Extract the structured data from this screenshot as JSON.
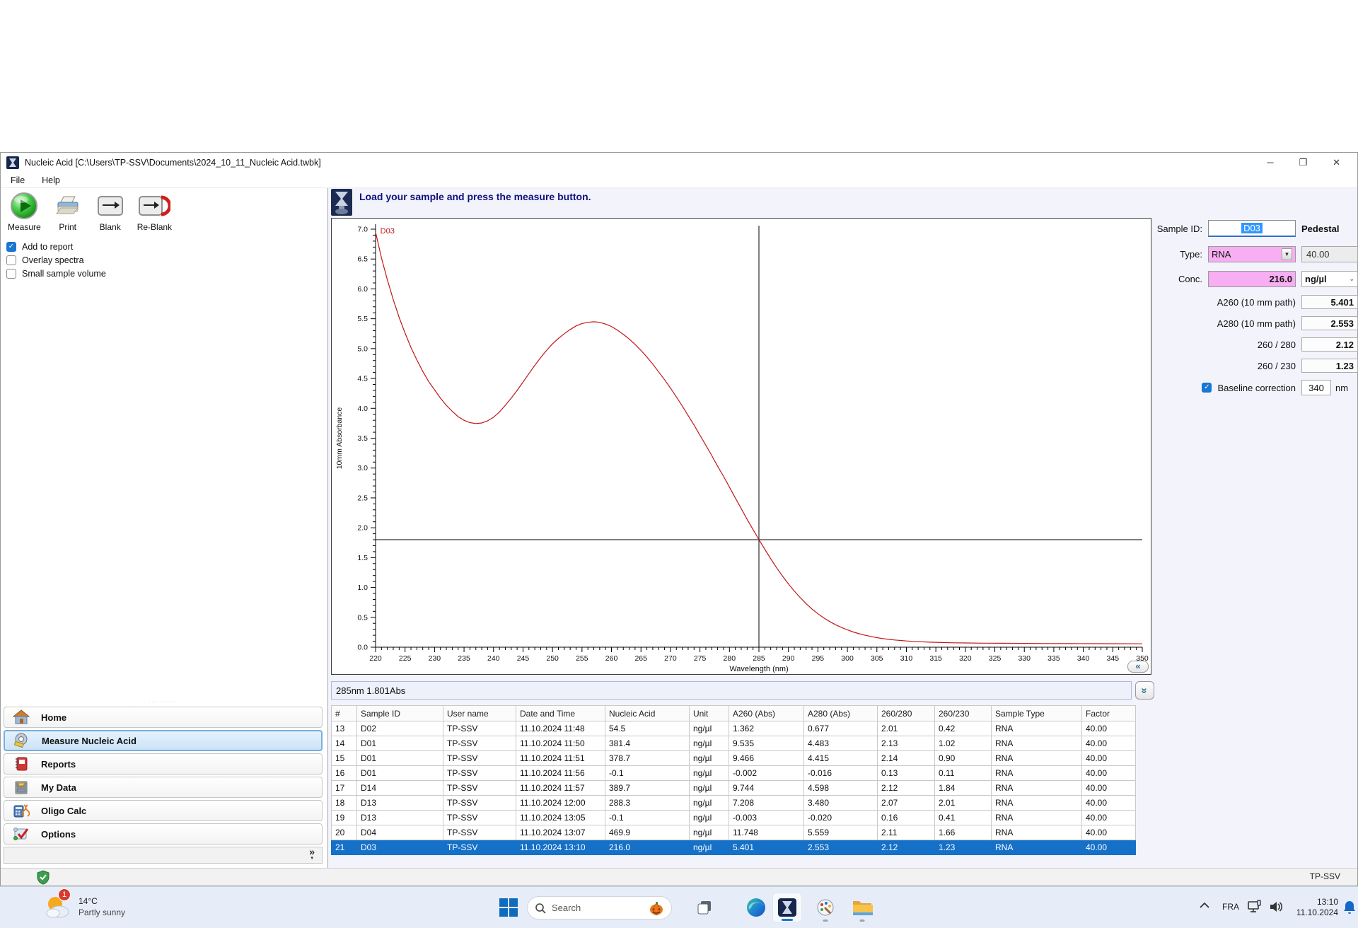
{
  "window": {
    "title": "Nucleic Acid  [C:\\Users\\TP-SSV\\Documents\\2024_10_11_Nucleic Acid.twbk]",
    "menu": [
      "File",
      "Help"
    ],
    "controls": {
      "minimize": "─",
      "maximize": "❐",
      "close": "✕"
    }
  },
  "toolbar": {
    "measure": "Measure",
    "print": "Print",
    "blank": "Blank",
    "reblank": "Re-Blank"
  },
  "options": [
    {
      "label": "Add to report",
      "checked": true
    },
    {
      "label": "Overlay spectra",
      "checked": false
    },
    {
      "label": "Small sample volume",
      "checked": false
    }
  ],
  "sidebar": {
    "items": [
      {
        "label": "Home"
      },
      {
        "label": "Measure Nucleic Acid"
      },
      {
        "label": "Reports"
      },
      {
        "label": "My Data"
      },
      {
        "label": "Oligo Calc"
      },
      {
        "label": "Options"
      }
    ],
    "selected_index": 1,
    "footer_glyph": "»",
    "footer_arrow": "▾"
  },
  "message_bar": {
    "text": "Load your sample and press the measure button."
  },
  "chart_data": {
    "type": "line",
    "title": "",
    "xlabel": "Wavelength (nm)",
    "ylabel": "10mm Absorbance",
    "xlim": [
      220,
      350
    ],
    "ylim": [
      0,
      7
    ],
    "x_major_step": 5,
    "x_minor_step": 1,
    "y_major_step": 0.5,
    "y_minor_step": 0.1,
    "grid": false,
    "crosshair": {
      "x": 285,
      "y": 1.801
    },
    "series": [
      {
        "name": "D03",
        "color": "#c01818",
        "label_pos": {
          "x": 220.8,
          "y": 6.93
        },
        "points": [
          [
            220,
            6.95
          ],
          [
            221,
            6.52
          ],
          [
            222,
            6.15
          ],
          [
            223,
            5.82
          ],
          [
            224,
            5.52
          ],
          [
            225,
            5.26
          ],
          [
            226,
            5.02
          ],
          [
            227,
            4.81
          ],
          [
            228,
            4.62
          ],
          [
            229,
            4.45
          ],
          [
            230,
            4.31
          ],
          [
            231,
            4.17
          ],
          [
            232,
            4.05
          ],
          [
            233,
            3.95
          ],
          [
            234,
            3.86
          ],
          [
            235,
            3.8
          ],
          [
            236,
            3.76
          ],
          [
            237,
            3.745
          ],
          [
            238,
            3.755
          ],
          [
            239,
            3.79
          ],
          [
            240,
            3.85
          ],
          [
            241,
            3.94
          ],
          [
            242,
            4.05
          ],
          [
            243,
            4.17
          ],
          [
            244,
            4.3
          ],
          [
            245,
            4.44
          ],
          [
            246,
            4.58
          ],
          [
            247,
            4.72
          ],
          [
            248,
            4.85
          ],
          [
            249,
            4.97
          ],
          [
            250,
            5.08
          ],
          [
            251,
            5.17
          ],
          [
            252,
            5.25
          ],
          [
            253,
            5.32
          ],
          [
            254,
            5.38
          ],
          [
            255,
            5.42
          ],
          [
            256,
            5.44
          ],
          [
            257,
            5.45
          ],
          [
            258,
            5.44
          ],
          [
            259,
            5.41
          ],
          [
            260,
            5.37
          ],
          [
            261,
            5.31
          ],
          [
            262,
            5.24
          ],
          [
            263,
            5.16
          ],
          [
            264,
            5.07
          ],
          [
            265,
            4.97
          ],
          [
            266,
            4.86
          ],
          [
            267,
            4.74
          ],
          [
            268,
            4.61
          ],
          [
            269,
            4.48
          ],
          [
            270,
            4.34
          ],
          [
            271,
            4.19
          ],
          [
            272,
            4.04
          ],
          [
            273,
            3.88
          ],
          [
            274,
            3.72
          ],
          [
            275,
            3.55
          ],
          [
            276,
            3.38
          ],
          [
            277,
            3.21
          ],
          [
            278,
            3.03
          ],
          [
            279,
            2.86
          ],
          [
            280,
            2.68
          ],
          [
            281,
            2.5
          ],
          [
            282,
            2.32
          ],
          [
            283,
            2.14
          ],
          [
            284,
            1.97
          ],
          [
            285,
            1.801
          ],
          [
            286,
            1.64
          ],
          [
            287,
            1.48
          ],
          [
            288,
            1.33
          ],
          [
            289,
            1.19
          ],
          [
            290,
            1.06
          ],
          [
            291,
            0.94
          ],
          [
            292,
            0.83
          ],
          [
            293,
            0.73
          ],
          [
            294,
            0.64
          ],
          [
            295,
            0.56
          ],
          [
            296,
            0.49
          ],
          [
            297,
            0.43
          ],
          [
            298,
            0.375
          ],
          [
            299,
            0.33
          ],
          [
            300,
            0.29
          ],
          [
            301,
            0.255
          ],
          [
            302,
            0.225
          ],
          [
            303,
            0.2
          ],
          [
            304,
            0.18
          ],
          [
            305,
            0.16
          ],
          [
            306,
            0.145
          ],
          [
            307,
            0.132
          ],
          [
            308,
            0.121
          ],
          [
            309,
            0.112
          ],
          [
            310,
            0.104
          ],
          [
            312,
            0.092
          ],
          [
            314,
            0.084
          ],
          [
            316,
            0.078
          ],
          [
            318,
            0.074
          ],
          [
            320,
            0.071
          ],
          [
            323,
            0.068
          ],
          [
            326,
            0.066
          ],
          [
            330,
            0.064
          ],
          [
            334,
            0.062
          ],
          [
            338,
            0.06
          ],
          [
            342,
            0.059
          ],
          [
            346,
            0.058
          ],
          [
            350,
            0.057
          ]
        ]
      }
    ]
  },
  "spectrum_status": "285nm 1.801Abs",
  "chart_buttons": {
    "collapse": "«",
    "expand": "»"
  },
  "right_panel": {
    "sample_id_label": "Sample ID:",
    "sample_id_value": "D03",
    "mode": "Pedestal",
    "type_label": "Type:",
    "type_value": "RNA",
    "factor_value": "40.00",
    "conc_label": "Conc.",
    "conc_value": "216.0",
    "conc_unit": "ng/µl",
    "a260_label": "A260 (10 mm path)",
    "a260_value": "5.401",
    "a280_label": "A280 (10 mm path)",
    "a280_value": "2.553",
    "ratio1_label": "260 / 280",
    "ratio1_value": "2.12",
    "ratio2_label": "260 / 230",
    "ratio2_value": "1.23",
    "baseline": {
      "label": "Baseline correction",
      "checked": true,
      "value": "340",
      "unit": "nm"
    }
  },
  "table": {
    "headers": [
      "#",
      "Sample ID",
      "User name",
      "Date and Time",
      "Nucleic Acid",
      "Unit",
      "A260 (Abs)",
      "A280 (Abs)",
      "260/280",
      "260/230",
      "Sample Type",
      "Factor"
    ],
    "selected_row": 8,
    "rows": [
      [
        "13",
        "D02",
        "TP-SSV",
        "11.10.2024 11:48",
        "54.5",
        "ng/µl",
        "1.362",
        "0.677",
        "2.01",
        "0.42",
        "RNA",
        "40.00"
      ],
      [
        "14",
        "D01",
        "TP-SSV",
        "11.10.2024 11:50",
        "381.4",
        "ng/µl",
        "9.535",
        "4.483",
        "2.13",
        "1.02",
        "RNA",
        "40.00"
      ],
      [
        "15",
        "D01",
        "TP-SSV",
        "11.10.2024 11:51",
        "378.7",
        "ng/µl",
        "9.466",
        "4.415",
        "2.14",
        "0.90",
        "RNA",
        "40.00"
      ],
      [
        "16",
        "D01",
        "TP-SSV",
        "11.10.2024 11:56",
        "-0.1",
        "ng/µl",
        "-0.002",
        "-0.016",
        "0.13",
        "0.11",
        "RNA",
        "40.00"
      ],
      [
        "17",
        "D14",
        "TP-SSV",
        "11.10.2024 11:57",
        "389.7",
        "ng/µl",
        "9.744",
        "4.598",
        "2.12",
        "1.84",
        "RNA",
        "40.00"
      ],
      [
        "18",
        "D13",
        "TP-SSV",
        "11.10.2024 12:00",
        "288.3",
        "ng/µl",
        "7.208",
        "3.480",
        "2.07",
        "2.01",
        "RNA",
        "40.00"
      ],
      [
        "19",
        "D13",
        "TP-SSV",
        "11.10.2024 13:05",
        "-0.1",
        "ng/µl",
        "-0.003",
        "-0.020",
        "0.16",
        "0.41",
        "RNA",
        "40.00"
      ],
      [
        "20",
        "D04",
        "TP-SSV",
        "11.10.2024 13:07",
        "469.9",
        "ng/µl",
        "11.748",
        "5.559",
        "2.11",
        "1.66",
        "RNA",
        "40.00"
      ],
      [
        "21",
        "D03",
        "TP-SSV",
        "11.10.2024 13:10",
        "216.0",
        "ng/µl",
        "5.401",
        "2.553",
        "2.12",
        "1.23",
        "RNA",
        "40.00"
      ]
    ]
  },
  "app_status": {
    "user": "TP-SSV"
  },
  "taskbar": {
    "weather": {
      "temp": "14°C",
      "condition": "Partly sunny",
      "badge": "1"
    },
    "search_placeholder": "Search",
    "language": "FRA",
    "time": "13:10",
    "date": "11.10.2024"
  }
}
